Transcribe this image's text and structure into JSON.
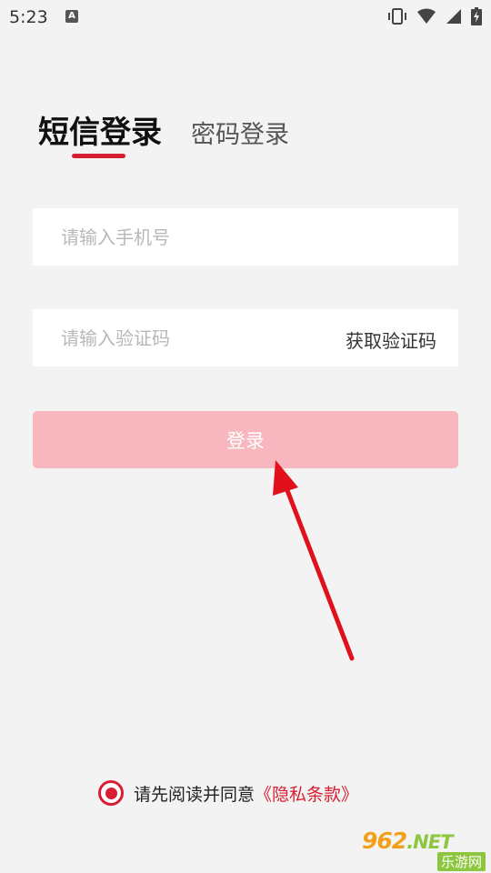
{
  "status_bar": {
    "time": "5:23",
    "notification_icon": "A"
  },
  "tabs": {
    "sms_login": "短信登录",
    "password_login": "密码登录"
  },
  "form": {
    "phone_placeholder": "请输入手机号",
    "code_placeholder": "请输入验证码",
    "get_code_label": "获取验证码",
    "login_label": "登录"
  },
  "agreement": {
    "text": "请先阅读并同意",
    "link_text": "《隐私条款》",
    "checked": true
  },
  "colors": {
    "accent": "#d81e32",
    "login_button_disabled": "#f8b6bf",
    "background": "#f3f3f3"
  },
  "watermark": {
    "site_number": "962",
    "site_suffix": ".NET",
    "site_name": "乐游网"
  }
}
